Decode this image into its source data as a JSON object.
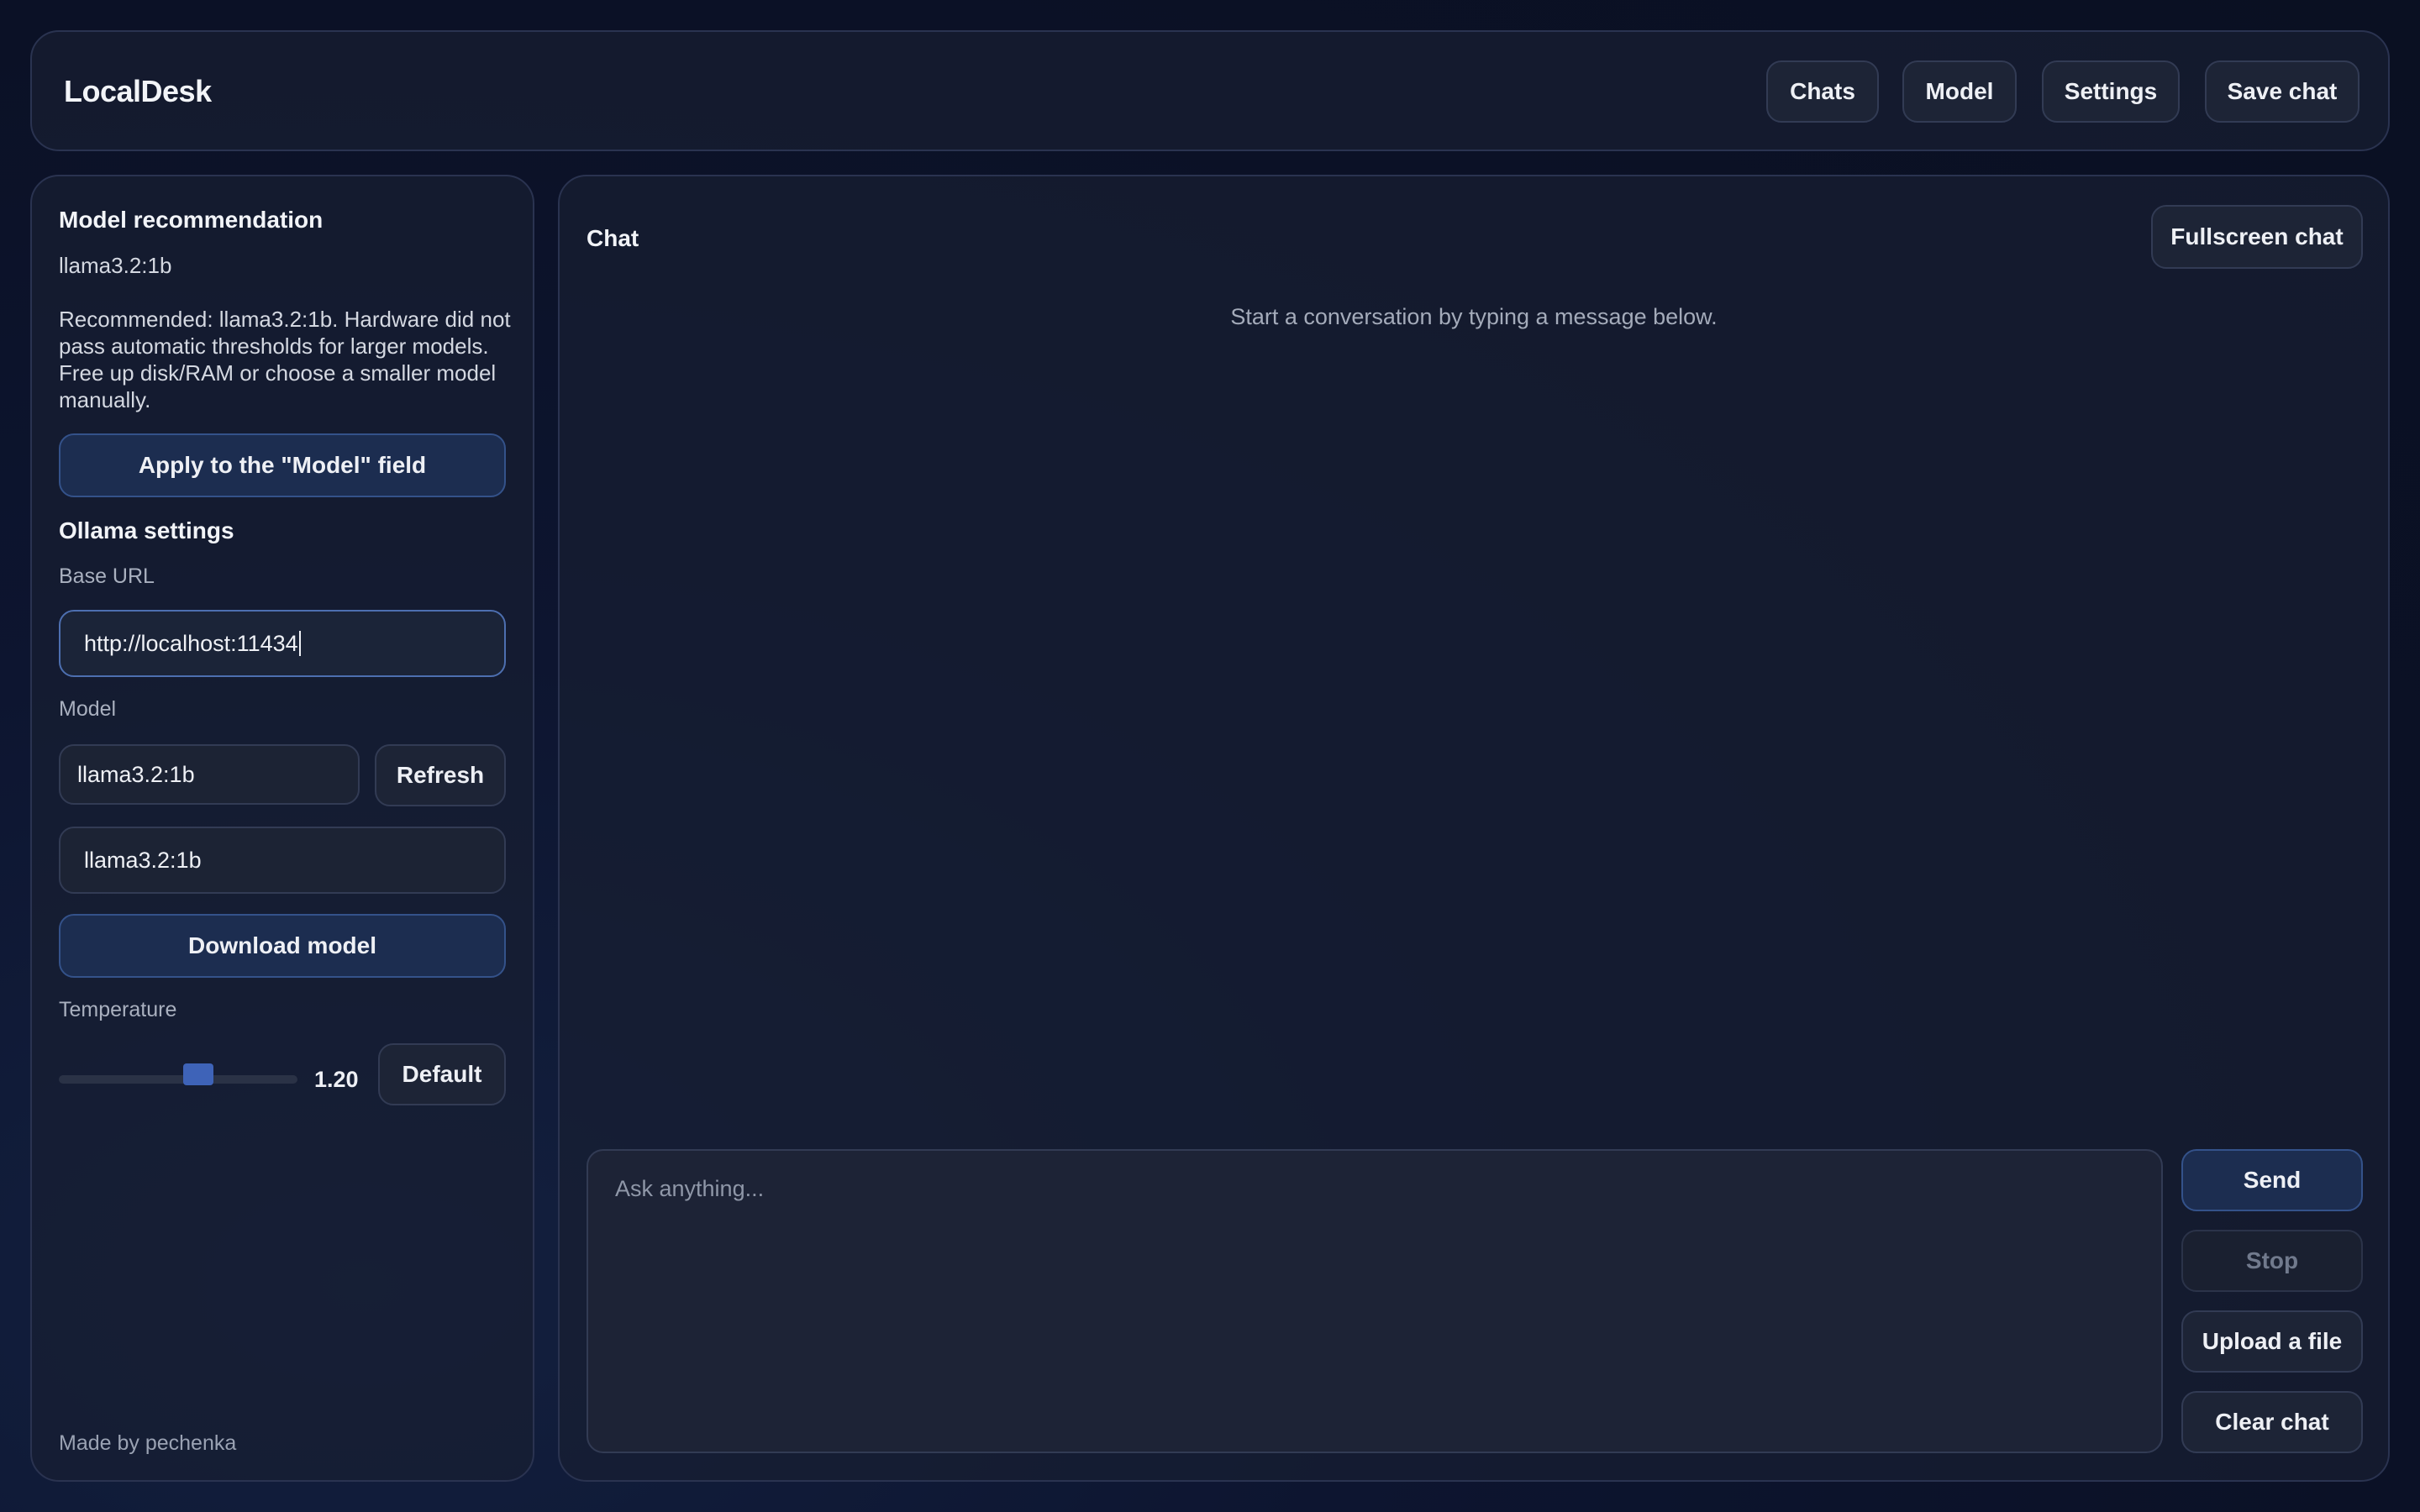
{
  "app": {
    "title": "LocalDesk"
  },
  "nav": {
    "chats": "Chats",
    "model": "Model",
    "settings": "Settings",
    "save_chat": "Save chat"
  },
  "sidebar": {
    "recommendation_heading": "Model recommendation",
    "recommended_model": "llama3.2:1b",
    "recommendation_text": "Recommended: llama3.2:1b. Hardware did not pass automatic thresholds for larger models. Free up disk/RAM or choose a smaller model manually.",
    "apply_button": "Apply to the \"Model\" field",
    "ollama_heading": "Ollama settings",
    "base_url_label": "Base URL",
    "base_url_value": "http://localhost:11434",
    "model_label": "Model",
    "model_select_value": "llama3.2:1b",
    "refresh_button": "Refresh",
    "download_input_value": "llama3.2:1b",
    "download_button": "Download model",
    "temperature_label": "Temperature",
    "temperature_value": "1.20",
    "default_button": "Default",
    "footer": "Made by pechenka"
  },
  "chat": {
    "title": "Chat",
    "fullscreen_button": "Fullscreen chat",
    "empty_message": "Start a conversation by typing a message below.",
    "input_placeholder": "Ask anything...",
    "send_button": "Send",
    "stop_button": "Stop",
    "upload_button": "Upload a file",
    "clear_button": "Clear chat"
  },
  "colors": {
    "background": "#0b1126",
    "panel": "#181f32",
    "primary_button": "#1c2d50",
    "accent": "#3e63b8"
  }
}
